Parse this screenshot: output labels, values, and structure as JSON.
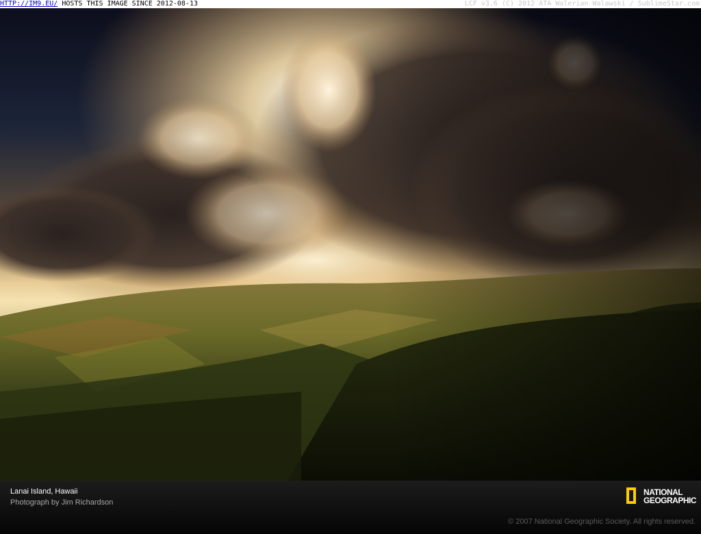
{
  "topbar": {
    "link_text": "HTTP://IM9.EU/",
    "hosts_text": " HOSTS THIS IMAGE SINCE 2012-08-13",
    "right_text": "LCF v3.6 (C) 2012 ATA Walerian Walawski / SublimeStar.com"
  },
  "caption": {
    "title": "Lanai Island, Hawaii",
    "credit": "Photograph by Jim Richardson",
    "copyright": "© 2007 National Geographic Society. All rights reserved."
  },
  "logo": {
    "line1": "NATIONAL",
    "line2": "GEOGRAPHIC",
    "frame_color": "#ffcc00"
  }
}
